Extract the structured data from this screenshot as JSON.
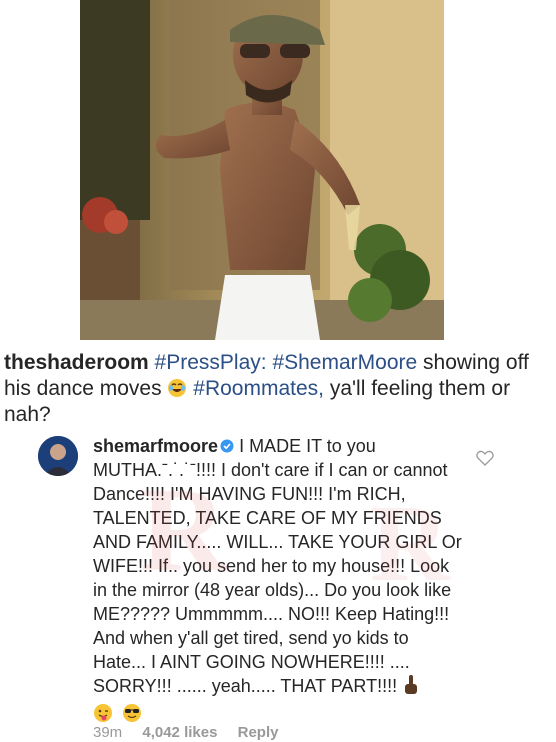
{
  "post": {
    "caption_user": "theshaderoom",
    "caption_hashtag1": "#PressPlay:",
    "caption_hashtag2": "#ShemarMoore",
    "caption_text1": "showing off his dance moves",
    "caption_hashtag3": "#Roommates,",
    "caption_text2": "ya'll feeling them or nah?"
  },
  "comment": {
    "username": "shemarfmoore",
    "text": "I MADE IT to you MUTHA.ˉ.˙.˙ˉ!!!! I don't care if I can or cannot Dance!!!! I'M HAVING FUN!!! I'm RICH, TALENTED, TAKE CARE OF MY FRIENDS AND FAMILY..... WILL... TAKE YOUR GIRL Or WIFE!!! If.. you send her to my house!!! Look in the mirror (48 year olds)... Do you look like ME????? Ummmmm.... NO!!! Keep Hating!!! And when y'all get tired, send yo kids to Hate... I AINT GOING NOWHERE!!!! .... SORRY!!! ...... yeah..... THAT PART!!!!",
    "time": "39m",
    "likes": "4,042 likes",
    "reply_label": "Reply"
  },
  "colors": {
    "hashtag": "#2b4f86",
    "meta_text": "#999999",
    "verified": "#3897f0"
  },
  "icons": [
    "verified-badge-icon",
    "heart-icon",
    "laughing-emoji-icon",
    "point-up-emoji-icon",
    "tongue-wink-emoji-icon",
    "sunglasses-emoji-icon"
  ]
}
